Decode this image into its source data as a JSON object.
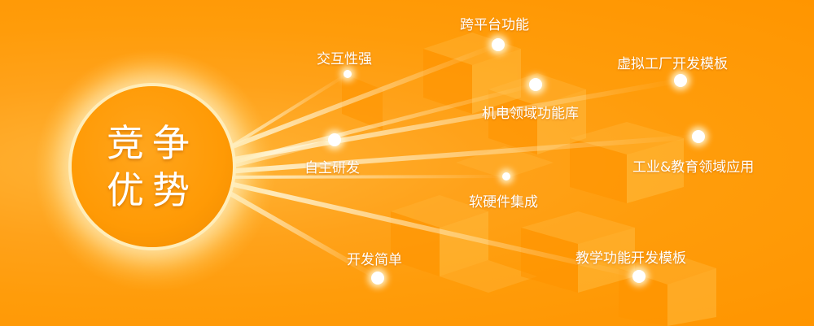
{
  "badge": {
    "line1": "竞争",
    "line2": "优势"
  },
  "features": [
    {
      "label": "跨平台功能"
    },
    {
      "label": "交互性强"
    },
    {
      "label": "虚拟工厂开发模板"
    },
    {
      "label": "机电领域功能库"
    },
    {
      "label": "自主研发"
    },
    {
      "label": "工业&教育领域应用"
    },
    {
      "label": "软硬件集成"
    },
    {
      "label": "开发简单"
    },
    {
      "label": "教学功能开发模板"
    }
  ],
  "colors": {
    "background": "#ff9c0a",
    "text": "#ffffff",
    "dot": "#ffffff"
  }
}
